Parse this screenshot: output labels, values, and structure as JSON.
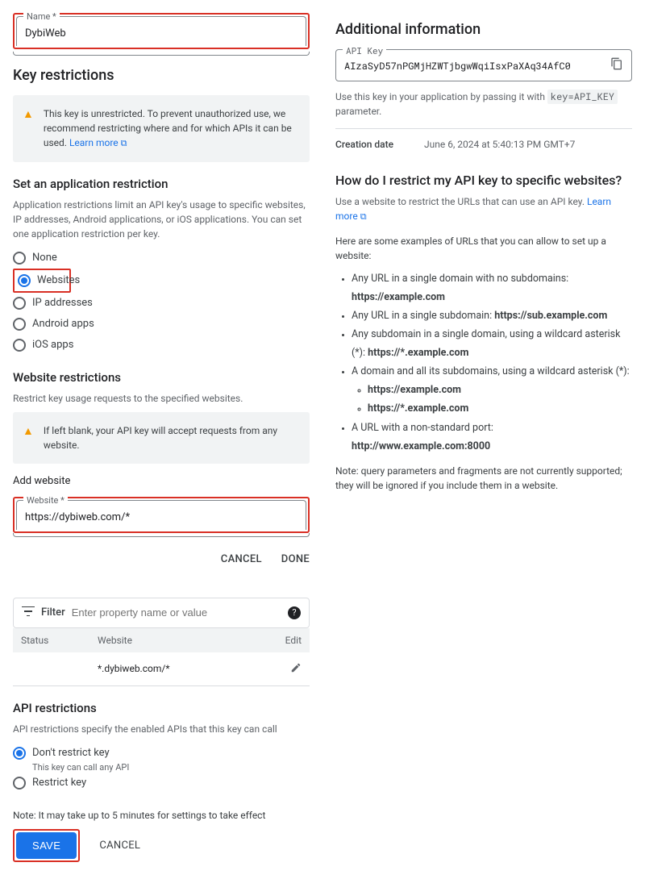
{
  "left": {
    "name": {
      "label": "Name *",
      "value": "DybiWeb"
    },
    "keyRestrictions": {
      "heading": "Key restrictions",
      "warning_pre": "This key is unrestricted. To prevent unauthorized use, we recommend restricting where and for which APIs it can be used. ",
      "learn_more": "Learn more"
    },
    "appRestriction": {
      "heading": "Set an application restriction",
      "desc": "Application restrictions limit an API key's usage to specific websites, IP addresses, Android applications, or iOS applications. You can set one application restriction per key.",
      "options": {
        "none": "None",
        "websites": "Websites",
        "ip": "IP addresses",
        "android": "Android apps",
        "ios": "iOS apps"
      }
    },
    "websiteRestrictions": {
      "heading": "Website restrictions",
      "desc": "Restrict key usage requests to the specified websites.",
      "warning": "If left blank, your API key will accept requests from any website.",
      "addWebsite": {
        "heading": "Add website",
        "label": "Website *",
        "value": "https://dybiweb.com/*"
      },
      "cancel": "CANCEL",
      "done": "DONE"
    },
    "filter": {
      "label": "Filter",
      "placeholder": "Enter property name or value"
    },
    "table": {
      "headers": {
        "status": "Status",
        "website": "Website",
        "edit": "Edit"
      },
      "row_website": "*.dybiweb.com/*"
    },
    "apiRestrictions": {
      "heading": "API restrictions",
      "desc": "API restrictions specify the enabled APIs that this key can call",
      "dontRestrict": "Don't restrict key",
      "dontRestrictSub": "This key can call any API",
      "restrict": "Restrict key"
    },
    "footer": {
      "note": "Note: It may take up to 5 minutes for settings to take effect",
      "save": "SAVE",
      "cancel": "CANCEL"
    }
  },
  "right": {
    "heading": "Additional information",
    "apikey": {
      "label": "API Key",
      "value": "AIzaSyD57nPGMjHZWTjbgwWqiIsxPaXAq34AfC0"
    },
    "usage_pre": "Use this key in your application by passing it with ",
    "usage_code": "key=API_KEY",
    "usage_post": " parameter.",
    "creation": {
      "label": "Creation date",
      "value": "June 6, 2024 at 5:40:13 PM GMT+7"
    },
    "howto": {
      "heading": "How do I restrict my API key to specific websites?",
      "desc_pre": "Use a website to restrict the URLs that can use an API key. ",
      "learn_more": "Learn more",
      "examples_intro": "Here are some examples of URLs that you can allow to set up a website:",
      "ex1_pre": "Any URL in a single domain with no subdomains: ",
      "ex1_b": "https://example.com",
      "ex2_pre": "Any URL in a single subdomain: ",
      "ex2_b": "https://sub.example.com",
      "ex3_pre": "Any subdomain in a single domain, using a wildcard asterisk (*): ",
      "ex3_b": "https://*.example.com",
      "ex4_pre": "A domain and all its subdomains, using a wildcard asterisk (*):",
      "ex4_a": "https://example.com",
      "ex4_b": "https://*.example.com",
      "ex5_pre": "A URL with a non-standard port: ",
      "ex5_b": "http://www.example.com:8000",
      "note": "Note: query parameters and fragments are not currently supported; they will be ignored if you include them in a website."
    }
  }
}
